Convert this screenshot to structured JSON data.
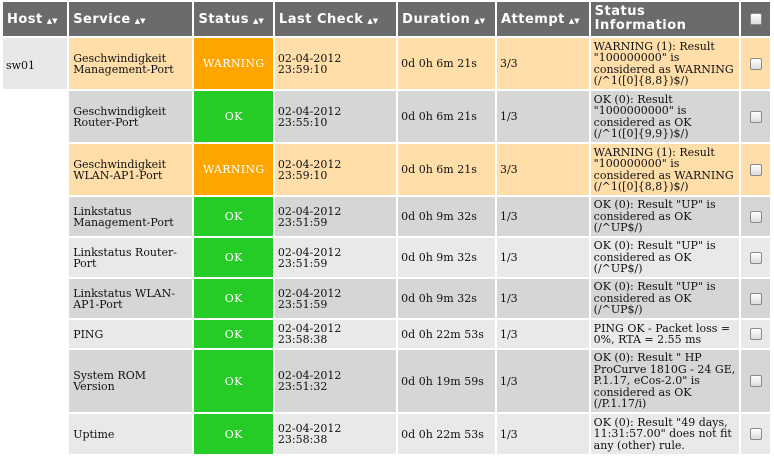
{
  "headers": {
    "host": "Host",
    "service": "Service",
    "status": "Status",
    "last_check": "Last Check",
    "duration": "Duration",
    "attempt": "Attempt",
    "status_info": "Status Information",
    "sort_glyph": "▲▼"
  },
  "host_name": "sw01",
  "rows": [
    {
      "service": "Geschwindigkeit Management-Port",
      "status": "WARNING",
      "last_check": "02-04-2012 23:59:10",
      "duration": "0d 0h 6m 21s",
      "attempt": "3/3",
      "info": "WARNING (1): Result \"100000000\" is considered as WARNING (/^1([0]{8,8})$/)"
    },
    {
      "service": "Geschwindigkeit Router-Port",
      "status": "OK",
      "last_check": "02-04-2012 23:55:10",
      "duration": "0d 0h 6m 21s",
      "attempt": "1/3",
      "info": "OK (0): Result \"1000000000\" is considered as OK (/^1([0]{9,9})$/)"
    },
    {
      "service": "Geschwindigkeit WLAN-AP1-Port",
      "status": "WARNING",
      "last_check": "02-04-2012 23:59:10",
      "duration": "0d 0h 6m 21s",
      "attempt": "3/3",
      "info": "WARNING (1): Result \"100000000\" is considered as WARNING (/^1([0]{8,8})$/)"
    },
    {
      "service": "Linkstatus Management-Port",
      "status": "OK",
      "last_check": "02-04-2012 23:51:59",
      "duration": "0d 0h 9m 32s",
      "attempt": "1/3",
      "info": "OK (0): Result \"UP\" is considered as OK (/^UP$/)"
    },
    {
      "service": "Linkstatus Router-Port",
      "status": "OK",
      "last_check": "02-04-2012 23:51:59",
      "duration": "0d 0h 9m 32s",
      "attempt": "1/3",
      "info": "OK (0): Result \"UP\" is considered as OK (/^UP$/)"
    },
    {
      "service": "Linkstatus WLAN-AP1-Port",
      "status": "OK",
      "last_check": "02-04-2012 23:51:59",
      "duration": "0d 0h 9m 32s",
      "attempt": "1/3",
      "info": "OK (0): Result \"UP\" is considered as OK (/^UP$/)"
    },
    {
      "service": "PING",
      "status": "OK",
      "last_check": "02-04-2012 23:58:38",
      "duration": "0d 0h 22m 53s",
      "attempt": "1/3",
      "info": "PING OK - Packet loss = 0%, RTA = 2.55 ms"
    },
    {
      "service": "System ROM Version",
      "status": "OK",
      "last_check": "02-04-2012 23:51:32",
      "duration": "0d 0h 19m 59s",
      "attempt": "1/3",
      "info": "OK (0): Result \" HP ProCurve 1810G - 24 GE, P.1.17, eCos-2.0\" is considered as OK (/P.1.17/i)"
    },
    {
      "service": "Uptime",
      "status": "OK",
      "last_check": "02-04-2012 23:58:38",
      "duration": "0d 0h 22m 53s",
      "attempt": "1/3",
      "info": "OK (0): Result \"49 days, 11:31:57.00\" does not fit any (other) rule."
    }
  ],
  "colors": {
    "header_bg": "#6b6b6b",
    "ok": "#26cc26",
    "warning": "#ffa500",
    "warning_row": "#ffdeaa",
    "ok_row_a": "#d6d6d6",
    "ok_row_b": "#e9e9e9"
  },
  "icons": {
    "sort": "sort-arrows-icon",
    "checkbox": "checkbox-icon"
  }
}
